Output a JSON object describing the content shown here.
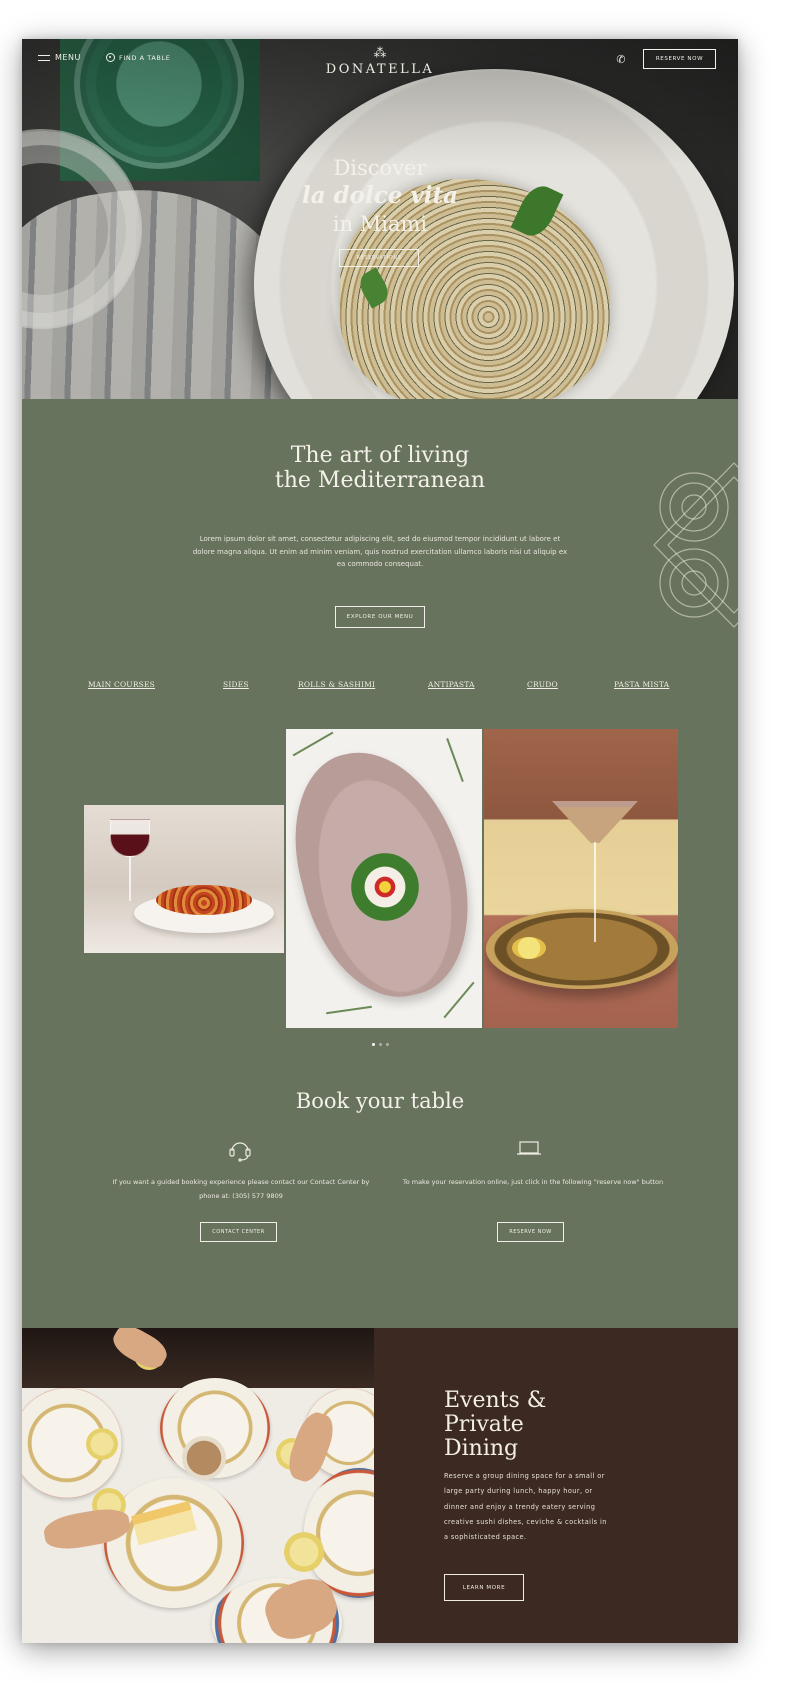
{
  "header": {
    "menu_label": "MENU",
    "find_label": "FIND A TABLE",
    "logo_text": "DONATELLA",
    "reserve_label": "RESERVE NOW"
  },
  "hero": {
    "line1": "Discover",
    "line2": "la dolce vita",
    "line3": "in Miami",
    "cta_label": "RESERVATIONS"
  },
  "art": {
    "title_line1": "The art of living",
    "title_line2": "the Mediterranean",
    "body": "Lorem ipsum dolor sit amet, consectetur adipiscing elit, sed do eiusmod tempor incididunt ut labore et dolore magna aliqua. Ut enim ad minim veniam, quis nostrud exercitation ullamco laboris nisi ut aliquip ex ea commodo consequat.",
    "cta_label": "EXPLORE OUR MENU"
  },
  "categories": [
    "MAIN COURSES",
    "SIDES",
    "ROLLS & SASHIMI",
    "ANTIPASTA",
    "CRUDO",
    "PASTA MISTA"
  ],
  "carousel": {
    "active_index": 0,
    "count": 3
  },
  "book": {
    "title": "Book your table",
    "left_text": "If you want a guided booking experience please contact our Contact Center by phone at: (305) 577 9809",
    "left_button": "CONTACT CENTER",
    "right_text": "To make your reservation online, just click in the following \"reserve now\" button",
    "right_button": "RESERVE NOW"
  },
  "events": {
    "title_line1": "Events &",
    "title_line2": "Private",
    "title_line3": "Dining",
    "body": "Reserve a group dining space for a small or large party during lunch, happy hour, or dinner and enjoy a trendy eatery serving creative sushi dishes, ceviche & cocktails in a sophisticated space.",
    "cta_label": "LEARN MORE"
  },
  "colors": {
    "sage": "#67735c",
    "espresso": "#3c2a22",
    "cream": "#f4f1ea"
  },
  "icons": [
    "menu-icon",
    "location-pin-icon",
    "phone-icon",
    "headset-icon",
    "laptop-icon"
  ]
}
